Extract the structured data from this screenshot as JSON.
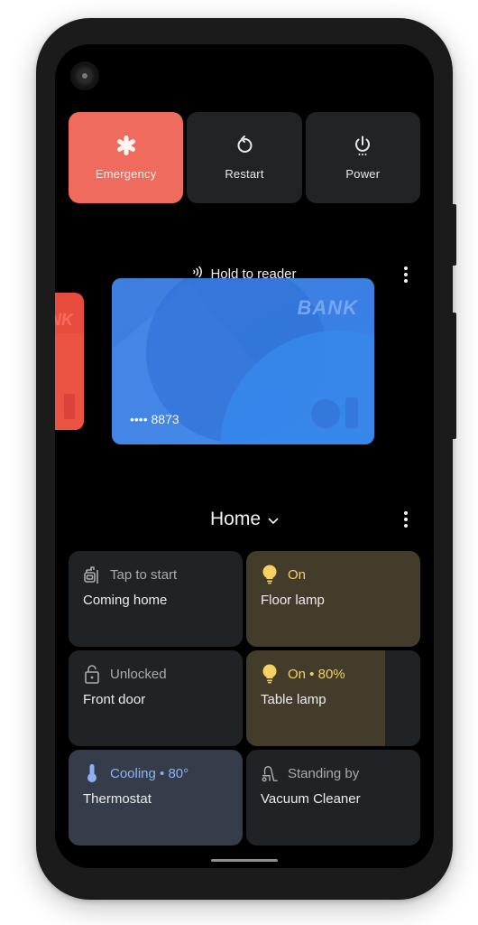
{
  "power_menu": {
    "buttons": [
      {
        "label": "Emergency",
        "icon": "asterisk-icon",
        "color": "#ee6b5e"
      },
      {
        "label": "Restart",
        "icon": "restart-icon"
      },
      {
        "label": "Power",
        "icon": "power-icon"
      }
    ]
  },
  "wallet": {
    "hold_label": "Hold to reader",
    "nfc_icon": "nfc-icon",
    "menu_icon": "more-vert-icon",
    "cards": [
      {
        "brand": "BANK",
        "number": "•••• 8873",
        "color": "#3a80e4",
        "active": true
      },
      {
        "brand": "NK",
        "color": "#e84c3d",
        "active": false
      }
    ]
  },
  "home": {
    "title": "Home",
    "dropdown_icon": "chevron-down-icon",
    "menu_icon": "more-vert-icon",
    "tiles": [
      {
        "status": "Tap to start",
        "name": "Coming home",
        "icon": "routine-icon",
        "state": "off"
      },
      {
        "status": "On",
        "name": "Floor lamp",
        "icon": "lightbulb-icon",
        "state": "on",
        "color": "#f6d063"
      },
      {
        "status": "Unlocked",
        "name": "Front door",
        "icon": "lock-open-icon",
        "state": "off"
      },
      {
        "status": "On • 80%",
        "name": "Table lamp",
        "icon": "lightbulb-icon",
        "state": "on",
        "brightness": 80,
        "color": "#f6d063"
      },
      {
        "status": "Cooling • 80°",
        "name": "Thermostat",
        "icon": "thermometer-icon",
        "state": "cooling",
        "color": "#8cb2f2"
      },
      {
        "status": "Standing by",
        "name": "Vacuum Cleaner",
        "icon": "vacuum-icon",
        "state": "off"
      }
    ]
  }
}
